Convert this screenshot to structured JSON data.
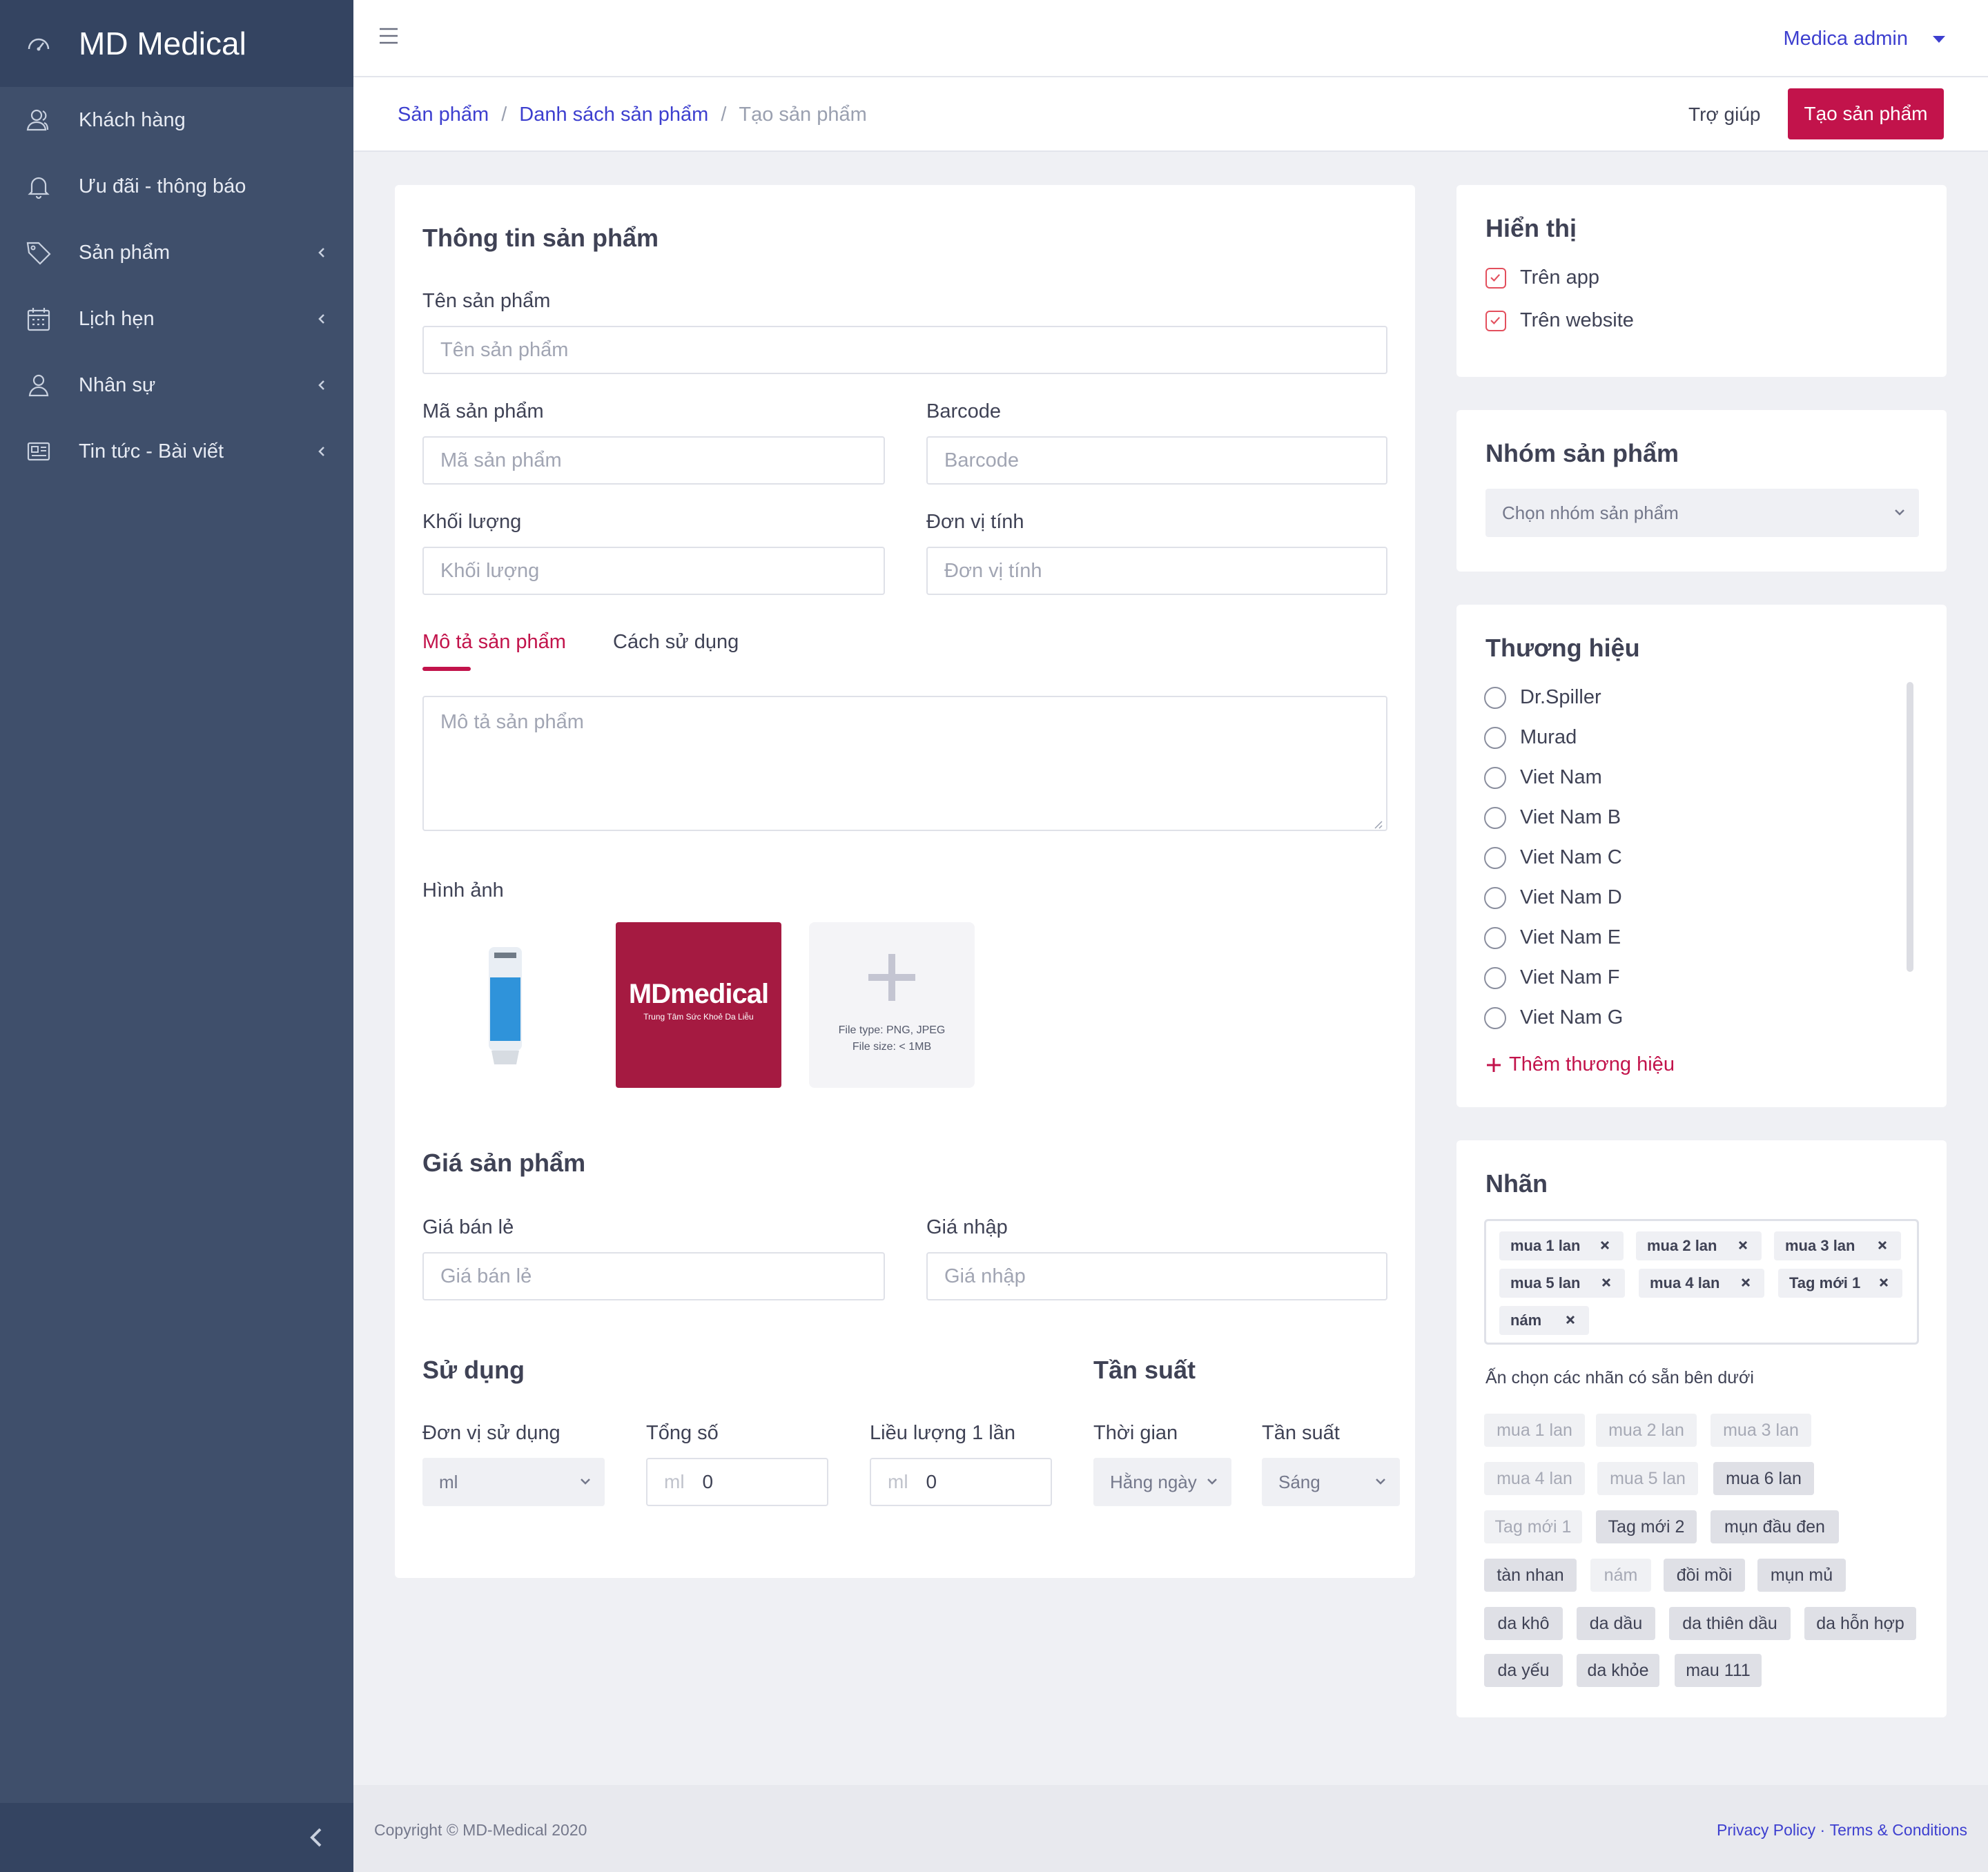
{
  "sidebar": {
    "brand": "MD Medical",
    "items": [
      {
        "label": "Khách hàng",
        "icon": "users-icon",
        "has_submenu": false
      },
      {
        "label": "Ưu đãi - thông báo",
        "icon": "bell-icon",
        "has_submenu": false
      },
      {
        "label": "Sản phẩm",
        "icon": "tag-icon",
        "has_submenu": true
      },
      {
        "label": "Lịch hẹn",
        "icon": "calendar-icon",
        "has_submenu": true
      },
      {
        "label": "Nhân sự",
        "icon": "user-icon",
        "has_submenu": true
      },
      {
        "label": "Tin tức - Bài viết",
        "icon": "newspaper-icon",
        "has_submenu": true
      }
    ]
  },
  "topbar": {
    "user": "Medica admin"
  },
  "breadcrumb": {
    "items": [
      "Sản phẩm",
      "Danh sách sản phẩm"
    ],
    "current": "Tạo sản phẩm"
  },
  "actions": {
    "help": "Trợ giúp",
    "create": "Tạo sản phẩm"
  },
  "product_info": {
    "title": "Thông tin sản phẩm",
    "name_label": "Tên sản phẩm",
    "name_placeholder": "Tên sản phẩm",
    "code_label": "Mã sản phẩm",
    "code_placeholder": "Mã sản phẩm",
    "barcode_label": "Barcode",
    "barcode_placeholder": "Barcode",
    "weight_label": "Khối lượng",
    "weight_placeholder": "Khối lượng",
    "unit_label": "Đơn vị tính",
    "unit_placeholder": "Đơn vị tính",
    "tabs": [
      "Mô tả sản phẩm",
      "Cách sử dụng"
    ],
    "active_tab": 0,
    "description_placeholder": "Mô tả sản phẩm",
    "images_label": "Hình ảnh",
    "logo_text": "MDmedical",
    "logo_subtext": "Trung Tâm Sức Khoẻ Da Liễu",
    "upload_hint_type": "File type: PNG, JPEG",
    "upload_hint_size": "File size: < 1MB"
  },
  "price": {
    "title": "Giá sản phẩm",
    "retail_label": "Giá bán lẻ",
    "retail_placeholder": "Giá bán lẻ",
    "import_label": "Giá nhập",
    "import_placeholder": "Giá nhập"
  },
  "usage": {
    "title": "Sử dụng",
    "unit_label": "Đơn vị sử dụng",
    "unit_value": "ml",
    "total_label": "Tổng số",
    "total_unit": "ml",
    "total_value": "0",
    "dose_label": "Liều lượng 1 lần",
    "dose_unit": "ml",
    "dose_value": "0"
  },
  "frequency": {
    "title": "Tần suất",
    "time_label": "Thời gian",
    "time_value": "Hằng ngày",
    "freq_label": "Tần suất",
    "freq_value": "Sáng"
  },
  "display": {
    "title": "Hiển thị",
    "options": [
      {
        "label": "Trên app",
        "checked": true
      },
      {
        "label": "Trên website",
        "checked": true
      }
    ]
  },
  "group": {
    "title": "Nhóm sản phẩm",
    "placeholder": "Chọn nhóm sản phẩm"
  },
  "brands": {
    "title": "Thương hiệu",
    "items": [
      "Dr.Spiller",
      "Murad",
      "Viet Nam",
      "Viet Nam B",
      "Viet Nam C",
      "Viet Nam D",
      "Viet Nam E",
      "Viet Nam F",
      "Viet Nam G"
    ],
    "add_label": "Thêm thương hiệu"
  },
  "labels": {
    "title": "Nhãn",
    "selected": [
      "mua 1 lan",
      "mua 2 lan",
      "mua 3 lan",
      "mua 5 lan",
      "mua 4 lan",
      "Tag mới 1",
      "nám"
    ],
    "hint": "Ấn chọn các nhãn có sẵn bên dưới",
    "available": [
      {
        "label": "mua 1 lan",
        "state": "dim"
      },
      {
        "label": "mua 2 lan",
        "state": "dim"
      },
      {
        "label": "mua 3 lan",
        "state": "dim"
      },
      {
        "label": "mua 4 lan",
        "state": "dim"
      },
      {
        "label": "mua 5 lan",
        "state": "dim"
      },
      {
        "label": "mua 6 lan",
        "state": "on"
      },
      {
        "label": "Tag mới 1",
        "state": "dim"
      },
      {
        "label": "Tag mới 2",
        "state": "on"
      },
      {
        "label": "mụn đầu đen",
        "state": "on"
      },
      {
        "label": "tàn nhan",
        "state": "on"
      },
      {
        "label": "nám",
        "state": "dim"
      },
      {
        "label": "đồi mồi",
        "state": "on"
      },
      {
        "label": "mụn mủ",
        "state": "on"
      },
      {
        "label": "da khô",
        "state": "on"
      },
      {
        "label": "da dầu",
        "state": "on"
      },
      {
        "label": "da thiên dầu",
        "state": "on"
      },
      {
        "label": "da hỗn hợp",
        "state": "on"
      },
      {
        "label": "da yếu",
        "state": "on"
      },
      {
        "label": "da khỏe",
        "state": "on"
      },
      {
        "label": "mau 111",
        "state": "on"
      }
    ]
  },
  "footer": {
    "copyright": "Copyright © MD-Medical 2020",
    "privacy": "Privacy Policy",
    "separator": " · ",
    "terms": "Terms & Conditions"
  },
  "colors": {
    "sidebar": "#3f4f6b",
    "accent": "#c2134b",
    "link": "#3d3fcf"
  }
}
